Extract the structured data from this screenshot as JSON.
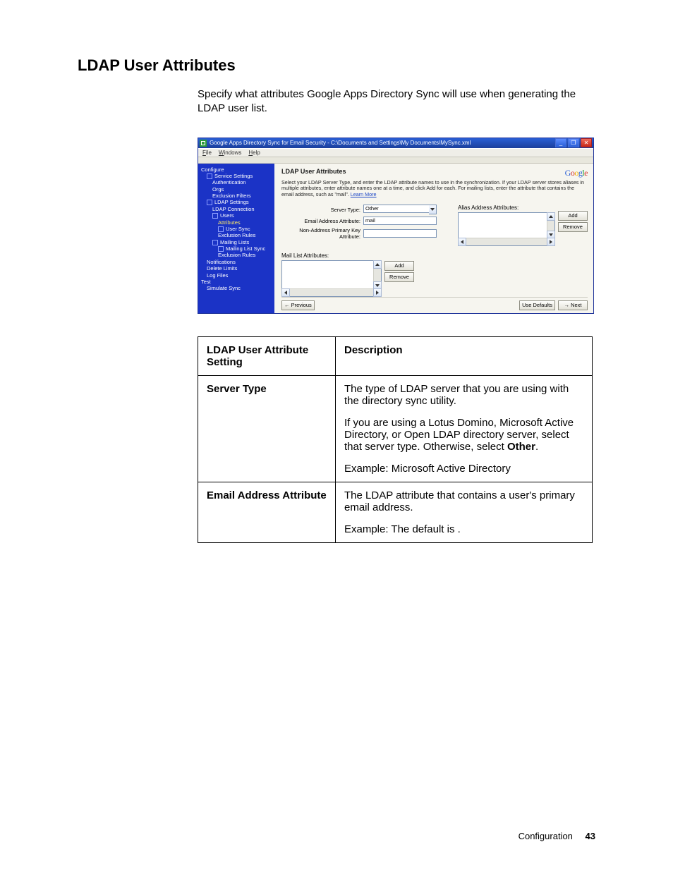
{
  "heading": "LDAP User Attributes",
  "intro": "Specify what attributes Google Apps Directory Sync will use when generating the LDAP user list.",
  "window": {
    "title": "Google Apps Directory Sync for Email Security - C:\\Documents and Settings\\My Documents\\MySync.xml",
    "menus": [
      "File",
      "Windows",
      "Help"
    ]
  },
  "tree": {
    "n0": "Configure",
    "n1": "Service Settings",
    "n1a": "Authentication",
    "n1b": "Orgs",
    "n1c": "Exclusion Filters",
    "n2": "LDAP Settings",
    "n2a": "LDAP Connection",
    "n2b": "Users",
    "n2b1": "Attributes",
    "n2b2": "User Sync",
    "n2b3": "Exclusion Rules",
    "n2c": "Mailing Lists",
    "n2c1": "Mailing List Sync",
    "n2c2": "Exclusion Rules",
    "n3": "Notifications",
    "n4": "Delete Limits",
    "n5": "Log Files",
    "n6": "Test",
    "n6a": "Simulate Sync"
  },
  "panel": {
    "title": "LDAP User Attributes",
    "help": "Select your LDAP Server Type, and enter the LDAP attribute names to use in the synchronization. If your LDAP server stores aliases in multiple attributes, enter attribute names one at a time, and click Add for each. For mailing lists, enter the attribute that contains the email address, such as \"mail\".",
    "learn_more": "Learn More",
    "labels": {
      "server_type": "Server Type:",
      "email_attr": "Email Address Attribute:",
      "nonaddr": "Non-Address Primary Key Attribute:",
      "mail_list": "Mail List Attributes:",
      "alias": "Alias Address Attributes:"
    },
    "values": {
      "server_type": "Other",
      "email_attr": "mail",
      "nonaddr": ""
    },
    "buttons": {
      "add": "Add",
      "remove": "Remove",
      "prev": "← Previous",
      "defaults": "Use Defaults",
      "next": "→ Next"
    }
  },
  "table": {
    "h1": "LDAP User Attribute Setting",
    "h2": "Description",
    "rows": [
      {
        "setting": "Server Type",
        "p1": "The type of LDAP server that you are using with the directory sync utility.",
        "p2a": "If you are using a Lotus Domino, Microsoft Active Directory, or Open LDAP directory server, select that server type. Otherwise, select ",
        "p2b": "Other",
        "p2c": ".",
        "p3": "Example: Microsoft Active Directory"
      },
      {
        "setting": "Email Address Attribute",
        "p1": "The LDAP attribute that contains a user's primary email address.",
        "p2": "Example: The default is       ."
      }
    ]
  },
  "footer": {
    "section": "Configuration",
    "page": "43"
  }
}
